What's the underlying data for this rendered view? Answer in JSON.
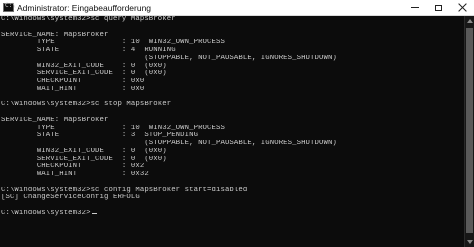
{
  "window": {
    "title": "Administrator: Eingabeaufforderung",
    "icon": "cmd-icon",
    "controls": [
      "minimize",
      "maximize",
      "close"
    ]
  },
  "console": {
    "lines": [
      "C:\\Windows\\system32>sc query MapsBroker",
      "",
      "SERVICE_NAME: MapsBroker",
      "        TYPE               : 10  WIN32_OWN_PROCESS",
      "        STATE              : 4  RUNNING",
      "                                (STOPPABLE, NOT_PAUSABLE, IGNORES_SHUTDOWN)",
      "        WIN32_EXIT_CODE    : 0  (0x0)",
      "        SERVICE_EXIT_CODE  : 0  (0x0)",
      "        CHECKPOINT         : 0x0",
      "        WAIT_HINT          : 0x0",
      "",
      "C:\\Windows\\system32>sc stop MapsBroker",
      "",
      "SERVICE_NAME: MapsBroker",
      "        TYPE               : 10  WIN32_OWN_PROCESS",
      "        STATE              : 3  STOP_PENDING",
      "                                (STOPPABLE, NOT_PAUSABLE, IGNORES_SHUTDOWN)",
      "        WIN32_EXIT_CODE    : 0  (0x0)",
      "        SERVICE_EXIT_CODE  : 0  (0x0)",
      "        CHECKPOINT         : 0x2",
      "        WAIT_HINT          : 0x32",
      "",
      "C:\\Windows\\system32>sc config MapsBroker start=disabled",
      "[SC] ChangeServiceConfig ERFOLG",
      "",
      "C:\\Windows\\system32>"
    ]
  },
  "colors": {
    "console_background": "#0c0c0c",
    "console_text": "#cccccc",
    "titlebar_background": "#ffffff"
  }
}
